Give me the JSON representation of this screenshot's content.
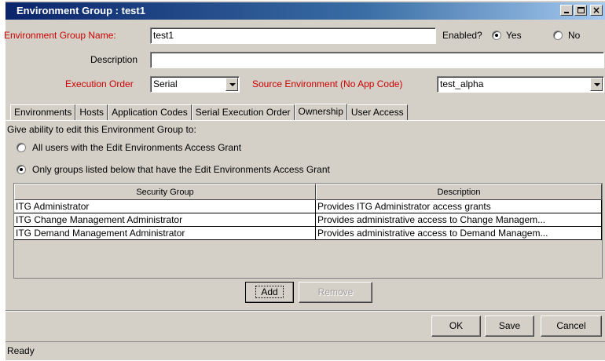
{
  "window": {
    "title": "Environment Group : test1"
  },
  "form": {
    "name_label": "Environment Group Name:",
    "name_value": "test1",
    "enabled_label": "Enabled?",
    "enabled_yes": "Yes",
    "enabled_no": "No",
    "enabled_selected": "Yes",
    "description_label": "Description",
    "description_value": "",
    "execution_order_label": "Execution Order",
    "execution_order_value": "Serial",
    "source_env_label": "Source Environment (No App Code)",
    "source_env_value": "test_alpha"
  },
  "tabs": [
    {
      "label": "Environments"
    },
    {
      "label": "Hosts"
    },
    {
      "label": "Application Codes"
    },
    {
      "label": "Serial Execution Order"
    },
    {
      "label": "Ownership",
      "active": true
    },
    {
      "label": "User Access"
    }
  ],
  "ownership": {
    "prompt": "Give ability to edit this Environment Group to:",
    "option_all": "All users with the Edit Environments Access Grant",
    "option_groups": "Only groups listed below that have the Edit Environments Access Grant",
    "selected": "option_groups",
    "table": {
      "headers": [
        "Security Group",
        "Description"
      ],
      "rows": [
        [
          "ITG Administrator",
          "Provides ITG Administrator access grants"
        ],
        [
          "ITG Change Management Administrator",
          "Provides administrative access to Change Managem..."
        ],
        [
          "ITG Demand Management Administrator",
          "Provides administrative access to Demand Managem..."
        ]
      ]
    },
    "add_label": "Add",
    "remove_label": "Remove"
  },
  "footer": {
    "ok_label": "OK",
    "save_label": "Save",
    "cancel_label": "Cancel"
  },
  "status": "Ready",
  "colors": {
    "required_label": "#cc0000",
    "title_bar": "#0a246a",
    "window_bg": "#d4d0c8"
  }
}
